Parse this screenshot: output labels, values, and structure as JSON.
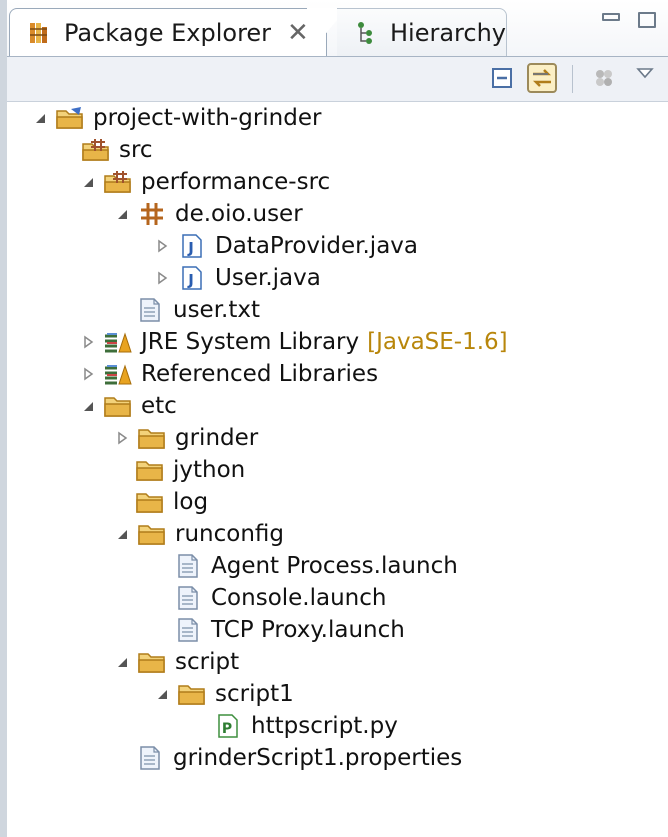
{
  "tabs": {
    "package_explorer": {
      "label": "Package Explorer",
      "close_glyph": "✕"
    },
    "hierarchy": {
      "label": "Hierarchy"
    }
  },
  "tree": {
    "root": "project-with-grinder",
    "src": "src",
    "performance_src": "performance-src",
    "package": "de.oio.user",
    "data_provider": "DataProvider.java",
    "user_java": "User.java",
    "user_txt": "user.txt",
    "jre_library": "JRE System Library",
    "jre_decoration": "[JavaSE-1.6]",
    "referenced_libraries": "Referenced Libraries",
    "etc": "etc",
    "grinder": "grinder",
    "jython": "jython",
    "log": "log",
    "runconfig": "runconfig",
    "agent_launch": "Agent Process.launch",
    "console_launch": "Console.launch",
    "tcp_launch": "TCP Proxy.launch",
    "script": "script",
    "script1": "script1",
    "httpscript": "httpscript.py",
    "properties": "grinderScript1.properties"
  },
  "colors": {
    "folder": "#e8b548",
    "package_brown": "#b5651d",
    "java_blue": "#2a5db0",
    "decoration": "#b8860b",
    "selection_border": "#9c8a5a"
  }
}
